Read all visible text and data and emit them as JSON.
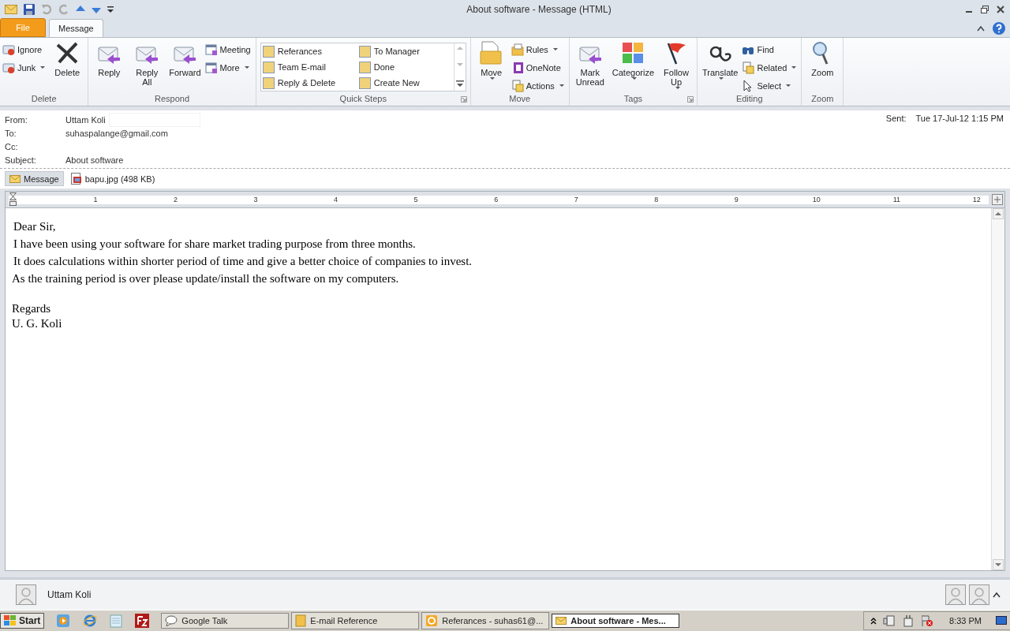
{
  "window": {
    "title": "About software  -  Message (HTML)"
  },
  "tabs": [
    {
      "label": "File",
      "kind": "file",
      "selected": false
    },
    {
      "label": "Message",
      "kind": "tab",
      "selected": true
    }
  ],
  "ribbon": [
    {
      "label": "Delete",
      "kind": "buttons",
      "items": [
        {
          "label": "Ignore",
          "kind": "small",
          "dropdown": false
        },
        {
          "label": "Junk",
          "kind": "small",
          "dropdown": true
        },
        {
          "label": "Delete",
          "kind": "large",
          "dropdown": false
        }
      ]
    },
    {
      "label": "Respond",
      "kind": "buttons",
      "items": [
        {
          "label": "Reply",
          "kind": "large",
          "dropdown": false
        },
        {
          "label": "Reply All",
          "kind": "large",
          "dropdown": false
        },
        {
          "label": "Forward",
          "kind": "large",
          "dropdown": false
        },
        {
          "label": "Meeting",
          "kind": "small",
          "dropdown": false
        },
        {
          "label": "More",
          "kind": "small",
          "dropdown": true
        }
      ]
    },
    {
      "label": "Quick Steps",
      "kind": "gallery",
      "items": [
        {
          "label": "Referances"
        },
        {
          "label": "To Manager"
        },
        {
          "label": "Team E-mail"
        },
        {
          "label": "Done"
        },
        {
          "label": "Reply & Delete"
        },
        {
          "label": "Create New"
        }
      ]
    },
    {
      "label": "Move",
      "kind": "buttons",
      "items": [
        {
          "label": "Move",
          "kind": "large",
          "dropdown": true
        },
        {
          "label": "Rules",
          "kind": "small",
          "dropdown": true
        },
        {
          "label": "OneNote",
          "kind": "small",
          "dropdown": false
        },
        {
          "label": "Actions",
          "kind": "small",
          "dropdown": true
        }
      ]
    },
    {
      "label": "Tags",
      "kind": "buttons",
      "items": [
        {
          "label": "Mark Unread",
          "kind": "large",
          "dropdown": false
        },
        {
          "label": "Categorize",
          "kind": "large",
          "dropdown": true
        },
        {
          "label": "Follow Up",
          "kind": "large",
          "dropdown": true
        }
      ]
    },
    {
      "label": "Editing",
      "kind": "buttons",
      "items": [
        {
          "label": "Translate",
          "kind": "large",
          "dropdown": true
        },
        {
          "label": "Find",
          "kind": "small",
          "dropdown": false
        },
        {
          "label": "Related",
          "kind": "small",
          "dropdown": true
        },
        {
          "label": "Select",
          "kind": "small",
          "dropdown": true
        }
      ]
    },
    {
      "label": "Zoom",
      "kind": "buttons",
      "items": [
        {
          "label": "Zoom",
          "kind": "large",
          "dropdown": false
        }
      ]
    }
  ],
  "header": {
    "fields": [
      {
        "label": "From:",
        "value": "Uttam Koli"
      },
      {
        "label": "To:",
        "value": "suhaspalange@gmail.com"
      },
      {
        "label": "Cc:"
      },
      {
        "label": "Subject:",
        "value": "About software"
      }
    ],
    "sent_label": "Sent:",
    "sent": "Tue 17-Jul-12 1:15 PM"
  },
  "attachments": [
    {
      "label": "Message",
      "kind": "message",
      "selected": true
    },
    {
      "label": "bapu.jpg (498 KB)",
      "kind": "file",
      "selected": false
    }
  ],
  "ruler": [
    "1",
    "2",
    "3",
    "4",
    "5",
    "6",
    "7",
    "8",
    "9",
    "10",
    "11",
    "12"
  ],
  "body": {
    "paragraphs": [
      "Dear Sir,",
      "I have been using your software for share market trading purpose from three months.",
      "It does calculations within shorter period of time and give a better choice of companies to invest.",
      "As the training period is over please update/install the software on my computers."
    ],
    "closing": [
      "Regards",
      "U. G. Koli"
    ]
  },
  "people_pane": {
    "name": "Uttam Koli"
  },
  "taskbar": {
    "start": "Start",
    "windows": [
      {
        "label": "Google Talk",
        "selected": false
      },
      {
        "label": "E-mail Reference",
        "selected": false
      },
      {
        "label": "Referances - suhas61@...",
        "selected": false
      },
      {
        "label": "About software - Mes...",
        "selected": true
      }
    ],
    "clock": "8:33 PM"
  }
}
